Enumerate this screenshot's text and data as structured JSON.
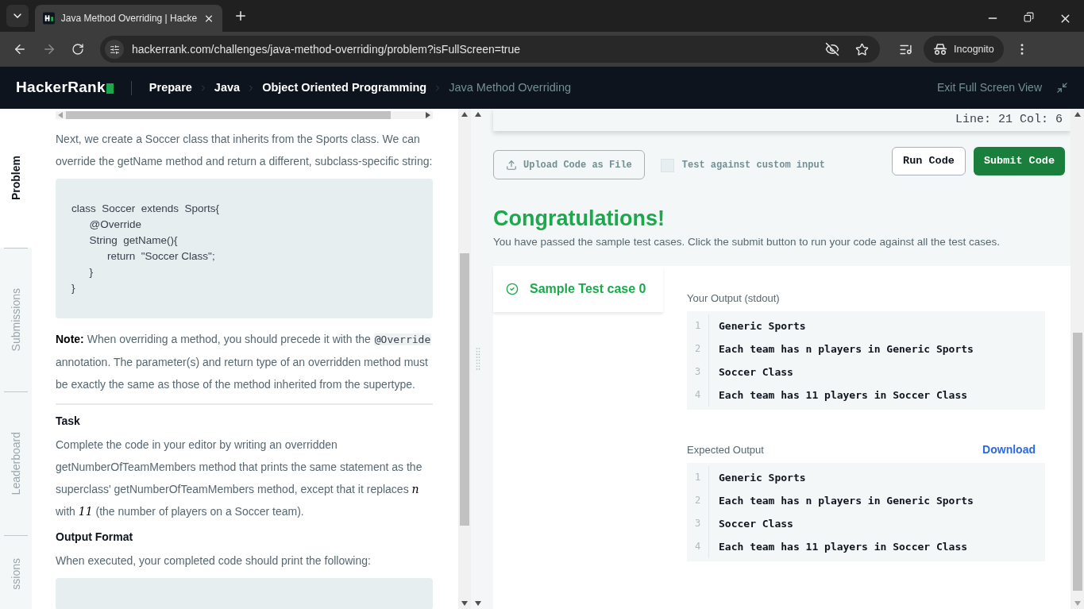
{
  "browser": {
    "tab_title": "Java Method Overriding | Hacke",
    "url": "hackerrank.com/challenges/java-method-overriding/problem?isFullScreen=true",
    "profile": "Incognito"
  },
  "header": {
    "logo": "HackerRank",
    "breadcrumbs": [
      {
        "label": "Prepare",
        "current": false
      },
      {
        "label": "Java",
        "current": false
      },
      {
        "label": "Object Oriented Programming",
        "current": false
      },
      {
        "label": "Java Method Overriding",
        "current": true
      }
    ],
    "exit": "Exit Full Screen View"
  },
  "side_tabs": [
    {
      "label": "Problem",
      "selected": true
    },
    {
      "label": "Submissions",
      "selected": false
    },
    {
      "label": "Leaderboard",
      "selected": false
    },
    {
      "label": "ssions",
      "selected": false
    }
  ],
  "problem": [
    {
      "kind": "para",
      "segments": [
        {
          "kind": "text",
          "text": "Next, we create a Soccer class that inherits from the Sports class. We can override the getName method and return a different, subclass-specific string:"
        }
      ]
    },
    {
      "kind": "code",
      "lines": [
        "class  Soccer  extends  Sports{",
        "      @Override",
        "      String  getName(){",
        "            return  \"Soccer Class\";",
        "      }",
        "}"
      ]
    },
    {
      "kind": "para",
      "segments": [
        {
          "kind": "bold",
          "text": "Note:"
        },
        {
          "kind": "text",
          "text": " When overriding a method, you should precede it with the "
        },
        {
          "kind": "code",
          "text": "@Override"
        },
        {
          "kind": "text",
          "text": " annotation. The parameter(s) and return type of an overridden method must be exactly the same as those of the method inherited from the supertype."
        }
      ]
    },
    {
      "kind": "divider"
    },
    {
      "kind": "heading",
      "text": "Task"
    },
    {
      "kind": "para",
      "segments": [
        {
          "kind": "text",
          "text": "Complete the code in your editor by writing an overridden getNumberOfTeamMembers method that prints the same statement as the superclass' getNumberOfTeamMembers method, except that it replaces "
        },
        {
          "kind": "math",
          "text": "n"
        },
        {
          "kind": "text",
          "text": " with "
        },
        {
          "kind": "math",
          "text": "11"
        },
        {
          "kind": "text",
          "text": " (the number of players on a Soccer team)."
        }
      ]
    },
    {
      "kind": "heading",
      "text": "Output Format"
    },
    {
      "kind": "para",
      "segments": [
        {
          "kind": "text",
          "text": "When executed, your completed code should print the following:"
        }
      ]
    },
    {
      "kind": "code"
    }
  ],
  "editor": {
    "status": "Line: 21 Col: 6",
    "upload": "Upload Code as File",
    "custom_input": {
      "label": "Test against custom input",
      "checked": false
    },
    "run": "Run Code",
    "submit": "Submit Code"
  },
  "result": {
    "title": "Congratulations!",
    "message": "You have passed the sample test cases. Click the submit button to run your code against all the test cases.",
    "test_cases": [
      {
        "label": "Sample Test case 0",
        "selected": true,
        "passed": true
      }
    ],
    "outputs": [
      {
        "label": "Your Output (stdout)",
        "lines": [
          {
            "number": "1",
            "text": "Generic Sports"
          },
          {
            "number": "2",
            "text": "Each team has n players in Generic Sports"
          },
          {
            "number": "3",
            "text": "Soccer Class"
          },
          {
            "number": "4",
            "text": "Each team has 11 players in Soccer Class"
          }
        ]
      },
      {
        "label": "Expected Output",
        "action": "Download",
        "lines": [
          {
            "number": "1",
            "text": "Generic Sports"
          },
          {
            "number": "2",
            "text": "Each team has n players in Generic Sports"
          },
          {
            "number": "3",
            "text": "Soccer Class"
          },
          {
            "number": "4",
            "text": "Each team has 11 players in Soccer Class"
          }
        ]
      }
    ]
  }
}
